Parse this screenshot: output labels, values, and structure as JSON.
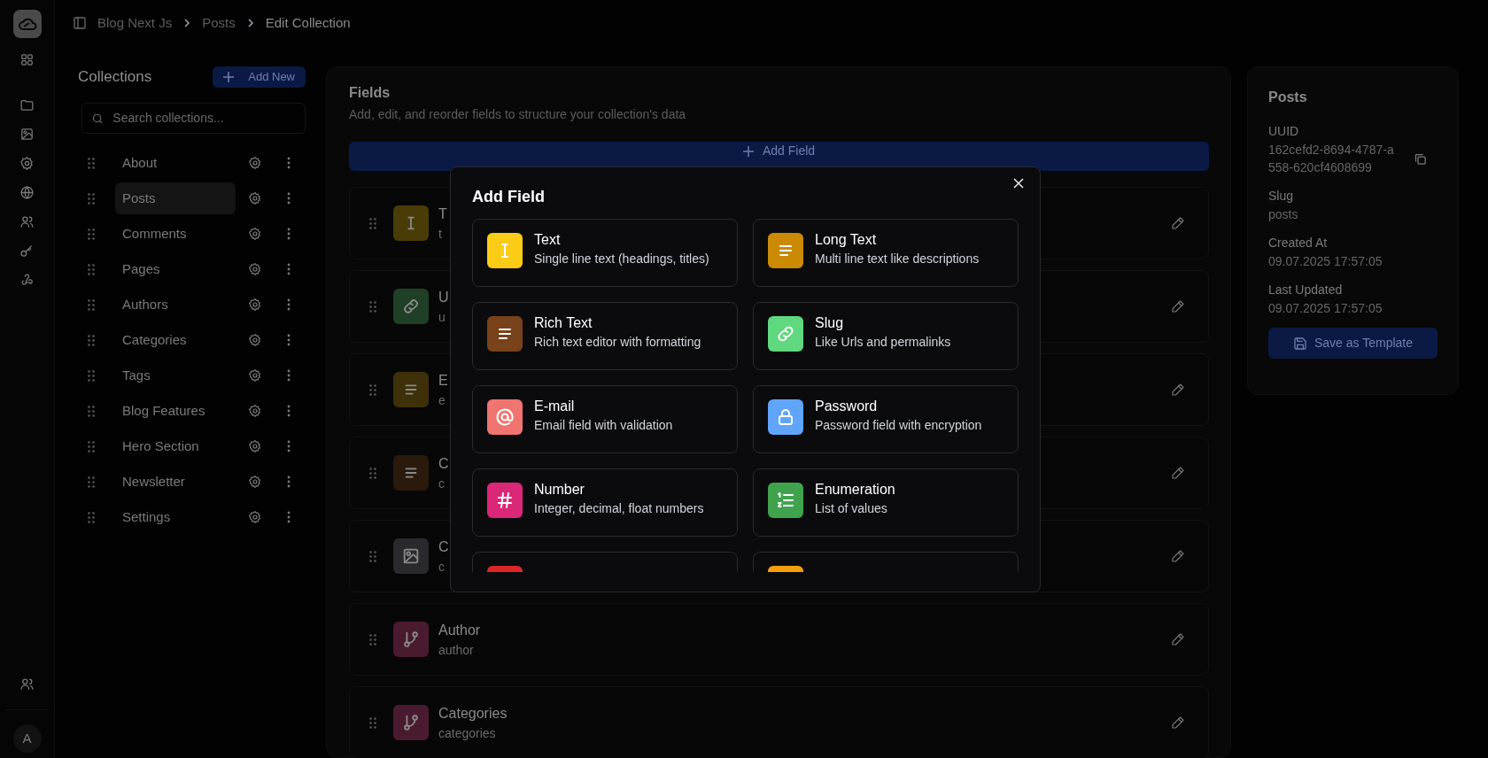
{
  "breadcrumb": [
    "Blog Next Js",
    "Posts",
    "Edit Collection"
  ],
  "collections": {
    "title": "Collections",
    "add_button": "Add New",
    "search": {
      "placeholder": "Search collections..."
    },
    "items": [
      {
        "label": "About",
        "selected": false
      },
      {
        "label": "Posts",
        "selected": true
      },
      {
        "label": "Comments",
        "selected": false
      },
      {
        "label": "Pages",
        "selected": false
      },
      {
        "label": "Authors",
        "selected": false
      },
      {
        "label": "Categories",
        "selected": false
      },
      {
        "label": "Tags",
        "selected": false
      },
      {
        "label": "Blog Features",
        "selected": false
      },
      {
        "label": "Hero Section",
        "selected": false
      },
      {
        "label": "Newsletter",
        "selected": false
      },
      {
        "label": "Settings",
        "selected": false
      }
    ]
  },
  "fields_panel": {
    "title": "Fields",
    "subtitle": "Add, edit, and reorder fields to structure your collection's data",
    "add_button": "Add Field",
    "fields": [
      {
        "kind": "text",
        "color": "#4a3c06",
        "title": "T",
        "subtitle": "t"
      },
      {
        "kind": "link",
        "color": "#1f3f26",
        "title": "U",
        "subtitle": "u"
      },
      {
        "kind": "lines",
        "color": "#3e3008",
        "title": "E",
        "subtitle": "e"
      },
      {
        "kind": "lines",
        "color": "#2a1a0c",
        "title": "C",
        "subtitle": "c"
      },
      {
        "kind": "image",
        "color": "#2a2a2e",
        "title": "C",
        "subtitle": "c"
      },
      {
        "kind": "relation",
        "color": "#4a1a30",
        "title": "Author",
        "subtitle": "author"
      },
      {
        "kind": "relation",
        "color": "#4a1a30",
        "title": "Categories",
        "subtitle": "categories"
      }
    ]
  },
  "details": {
    "title": "Posts",
    "entries": [
      {
        "label": "UUID",
        "value": "162cefd2-8694-4787-a558-620cf4608699",
        "copyable": true
      },
      {
        "label": "Slug",
        "value": "posts",
        "copyable": false
      },
      {
        "label": "Created At",
        "value": "09.07.2025 17:57:05",
        "copyable": false
      },
      {
        "label": "Last Updated",
        "value": "09.07.2025 17:57:05",
        "copyable": false
      }
    ],
    "save_button": "Save as Template"
  },
  "avatar": "A",
  "modal": {
    "title": "Add Field",
    "options": [
      {
        "kind": "text",
        "color": "#facc15",
        "title": "Text",
        "description": "Single line text (headings, titles)"
      },
      {
        "kind": "lines",
        "color": "#ca8a04",
        "title": "Long Text",
        "description": "Multi line text like descriptions"
      },
      {
        "kind": "lines",
        "color": "#78421a",
        "title": "Rich Text",
        "description": "Rich text editor with formatting"
      },
      {
        "kind": "link",
        "color": "#5fd87f",
        "title": "Slug",
        "description": "Like Urls and permalinks"
      },
      {
        "kind": "at",
        "color": "#f07470",
        "title": "E-mail",
        "description": "Email field with validation"
      },
      {
        "kind": "lock",
        "color": "#60a5fa",
        "title": "Password",
        "description": "Password field with encryption"
      },
      {
        "kind": "hash",
        "color": "#db2777",
        "title": "Number",
        "description": "Integer, decimal, float numbers"
      },
      {
        "kind": "list",
        "color": "#3fa34d",
        "title": "Enumeration",
        "description": "List of values"
      }
    ],
    "partial_options": [
      {
        "color": "#dc2626"
      },
      {
        "color": "#f59e0b"
      }
    ]
  }
}
